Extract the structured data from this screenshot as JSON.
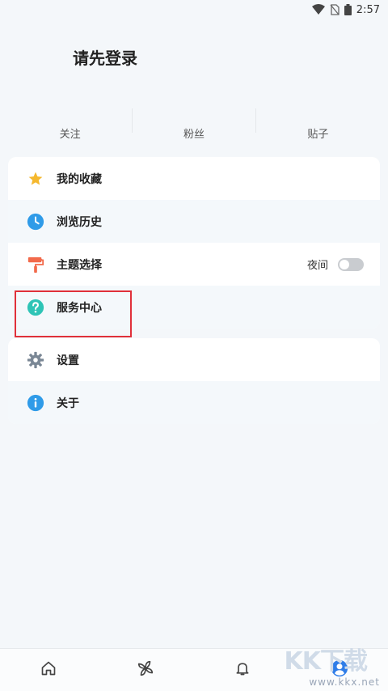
{
  "status_bar": {
    "time": "2:57"
  },
  "header": {
    "login_prompt": "请先登录"
  },
  "stats": [
    {
      "label": "关注"
    },
    {
      "label": "粉丝"
    },
    {
      "label": "贴子"
    }
  ],
  "menu_group_1": [
    {
      "label": "我的收藏",
      "icon": "star-icon",
      "color": "#f5b82e"
    },
    {
      "label": "浏览历史",
      "icon": "clock-icon",
      "color": "#2f9be8"
    },
    {
      "label": "主题选择",
      "icon": "paint-roller-icon",
      "color": "#f26a4b",
      "toggle_label": "夜间",
      "toggle_on": false
    },
    {
      "label": "服务中心",
      "icon": "help-icon",
      "color": "#2ec4b6"
    }
  ],
  "menu_group_2": [
    {
      "label": "设置",
      "icon": "gear-icon",
      "color": "#7a8795"
    },
    {
      "label": "关于",
      "icon": "info-icon",
      "color": "#2f9be8"
    }
  ],
  "tab_bar": [
    {
      "name": "home-tab",
      "icon": "home-icon",
      "active": false
    },
    {
      "name": "discover-tab",
      "icon": "pinwheel-icon",
      "active": false
    },
    {
      "name": "notifications-tab",
      "icon": "bell-icon",
      "active": false
    },
    {
      "name": "profile-tab",
      "icon": "user-icon",
      "active": true
    }
  ],
  "watermark": {
    "big": "KK下载",
    "url": "www.kkx.net"
  }
}
